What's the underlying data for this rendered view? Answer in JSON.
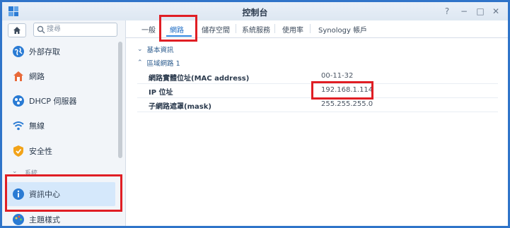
{
  "window": {
    "title": "控制台"
  },
  "controls": {
    "help": "?",
    "minimize": "−",
    "maximize": "□",
    "close": "✕"
  },
  "search": {
    "placeholder": "搜尋"
  },
  "sidebar": {
    "items": [
      {
        "label": "外部存取",
        "icon": "globe-icon"
      },
      {
        "label": "網路",
        "icon": "house-icon"
      },
      {
        "label": "DHCP 伺服器",
        "icon": "dhcp-icon"
      },
      {
        "label": "無線",
        "icon": "wifi-icon"
      },
      {
        "label": "安全性",
        "icon": "shield-icon"
      }
    ],
    "section_label": "系統",
    "active_item": {
      "label": "資訊中心",
      "icon": "info-icon"
    },
    "last_item": {
      "label": "主題樣式",
      "icon": "palette-icon"
    }
  },
  "tabs": [
    "一般",
    "網路",
    "儲存空間",
    "系統服務",
    "使用率",
    "Synology 帳戶"
  ],
  "active_tab": "網路",
  "sections": {
    "basic": "基本資訊",
    "lan": "區域網路 1"
  },
  "rows": [
    {
      "label": "網路實體位址(MAC address)",
      "value": "00-11-32"
    },
    {
      "label": "IP 位址",
      "value": "192.168.1.114"
    },
    {
      "label": "子網路遮罩(mask)",
      "value": "255.255.255.0"
    }
  ],
  "colors": {
    "accent": "#2f86e0",
    "highlight": "#e01e24",
    "active_bg": "#d5e8fb"
  }
}
